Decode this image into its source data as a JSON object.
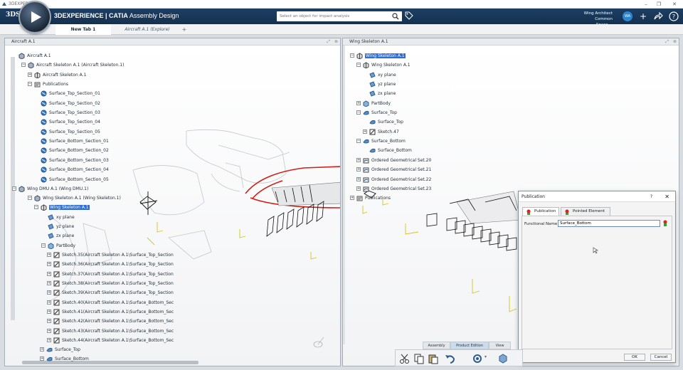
{
  "os": {
    "title": "3DEXPERIENCE",
    "minimize": "–",
    "restore": "❐",
    "close": "✕"
  },
  "header": {
    "brand_logo": "3DS",
    "app_prefix": "3DEXPERIENCE | CATIA",
    "app_name": "Assembly Design",
    "search_placeholder": "Select an object for impact analysis",
    "role": "Wing Architect",
    "space": "Common Space ⌄",
    "avatar_initials": "WA",
    "icons": [
      "plus-icon",
      "share-icon",
      "help-icon"
    ]
  },
  "tabs": [
    {
      "label": "New Tab 1",
      "active": true
    },
    {
      "label": "Aircraft A.1 (Explore)",
      "active": false
    },
    {
      "label": "+",
      "active": false
    }
  ],
  "left_window": {
    "title": "Aircraft A.1",
    "tree": [
      {
        "label": "Aircraft A.1",
        "icon": "product",
        "selected": false
      },
      {
        "label": "Aircraft Skeleton A.1 (Aircraft Skeleton.1)",
        "icon": "product",
        "selected": false
      },
      {
        "label": "Aircraft Skeleton A.1",
        "icon": "part",
        "selected": false
      },
      {
        "label": "Publications",
        "icon": "publications",
        "selected": false
      },
      {
        "label": "Surface_Top_Section_01",
        "icon": "publication",
        "selected": false
      },
      {
        "label": "Surface_Top_Section_02",
        "icon": "publication",
        "selected": false
      },
      {
        "label": "Surface_Top_Section_03",
        "icon": "publication",
        "selected": false
      },
      {
        "label": "Surface_Top_Section_04",
        "icon": "publication",
        "selected": false
      },
      {
        "label": "Surface_Top_Section_05",
        "icon": "publication",
        "selected": false
      },
      {
        "label": "Surface_Bottom_Section_01",
        "icon": "publication",
        "selected": false
      },
      {
        "label": "Surface_Bottom_Section_02",
        "icon": "publication",
        "selected": false
      },
      {
        "label": "Surface_Bottom_Section_03",
        "icon": "publication",
        "selected": false
      },
      {
        "label": "Surface_Bottom_Section_04",
        "icon": "publication",
        "selected": false
      },
      {
        "label": "Surface_Bottom_Section_05",
        "icon": "publication",
        "selected": false
      },
      {
        "label": "Wing DMU A.1 (Wing DMU.1)",
        "icon": "product",
        "selected": false
      },
      {
        "label": "Wing Skeleton A.1 (Wing Skeleton.1)",
        "icon": "product",
        "selected": false
      },
      {
        "label": "Wing Skeleton A.1",
        "icon": "part",
        "selected": true
      },
      {
        "label": "xy plane",
        "icon": "plane",
        "selected": false
      },
      {
        "label": "yz plane",
        "icon": "plane",
        "selected": false
      },
      {
        "label": "zx plane",
        "icon": "plane",
        "selected": false
      },
      {
        "label": "PartBody",
        "icon": "body",
        "selected": false
      },
      {
        "label": "Sketch.35(Aircraft Skeleton A.1\\Surface_Top_Section",
        "icon": "sketch",
        "selected": false
      },
      {
        "label": "Sketch.36(Aircraft Skeleton A.1\\Surface_Top_Section",
        "icon": "sketch",
        "selected": false
      },
      {
        "label": "Sketch.37(Aircraft Skeleton A.1\\Surface_Top_Section",
        "icon": "sketch",
        "selected": false
      },
      {
        "label": "Sketch.38(Aircraft Skeleton A.1\\Surface_Top_Section",
        "icon": "sketch",
        "selected": false
      },
      {
        "label": "Sketch.39(Aircraft Skeleton A.1\\Surface_Top_Section",
        "icon": "sketch",
        "selected": false
      },
      {
        "label": "Sketch.40(Aircraft Skeleton A.1\\Surface_Bottom_Sec",
        "icon": "sketch",
        "selected": false
      },
      {
        "label": "Sketch.41(Aircraft Skeleton A.1\\Surface_Bottom_Sec",
        "icon": "sketch",
        "selected": false
      },
      {
        "label": "Sketch.42(Aircraft Skeleton A.1\\Surface_Bottom_Sec",
        "icon": "sketch",
        "selected": false
      },
      {
        "label": "Sketch.43(Aircraft Skeleton A.1\\Surface_Bottom_Sec",
        "icon": "sketch",
        "selected": false
      },
      {
        "label": "Sketch.44(Aircraft Skeleton A.1\\Surface_Bottom_Sec",
        "icon": "sketch",
        "selected": false
      },
      {
        "label": "Surface_Top",
        "icon": "surface",
        "selected": false
      },
      {
        "label": "Surface_Bottom",
        "icon": "surface",
        "selected": false
      }
    ]
  },
  "right_window": {
    "title": "Wing Skeleton A.1",
    "tree": [
      {
        "label": "Wing Skeleton A.1",
        "icon": "part",
        "selected": true
      },
      {
        "label": "Wing Skeleton A.1",
        "icon": "part",
        "selected": false
      },
      {
        "label": "xy plane",
        "icon": "plane",
        "selected": false
      },
      {
        "label": "yz plane",
        "icon": "plane",
        "selected": false
      },
      {
        "label": "zx plane",
        "icon": "plane",
        "selected": false
      },
      {
        "label": "PartBody",
        "icon": "body",
        "selected": false
      },
      {
        "label": "Surface_Top",
        "icon": "surface",
        "selected": false
      },
      {
        "label": "Surface_Top",
        "icon": "surface",
        "selected": false
      },
      {
        "label": "Sketch.47",
        "icon": "sketch",
        "selected": false
      },
      {
        "label": "Surface_Bottom",
        "icon": "surface",
        "selected": false
      },
      {
        "label": "Surface_Bottom",
        "icon": "surface",
        "selected": false
      },
      {
        "label": "Ordered Geometrical Set.20",
        "icon": "geoset",
        "selected": false
      },
      {
        "label": "Ordered Geometrical Set.21",
        "icon": "geoset",
        "selected": false
      },
      {
        "label": "Ordered Geometrical Set.22",
        "icon": "geoset",
        "selected": false
      },
      {
        "label": "Ordered Geometrical Set.23",
        "icon": "geoset",
        "selected": false
      },
      {
        "label": "Publications",
        "icon": "publications",
        "selected": false
      }
    ]
  },
  "dialog": {
    "title": "Publication",
    "help": "?",
    "close": "✕",
    "tabs": [
      {
        "label": "Publication",
        "active": true
      },
      {
        "label": "Pointed Element",
        "active": false
      }
    ],
    "functional_name_label": "Functional Name",
    "functional_name_value": "Surface_Bottom",
    "ok_label": "OK",
    "cancel_label": "Cancel"
  },
  "action_bar": {
    "tabs": [
      {
        "label": "Assembly",
        "active": false
      },
      {
        "label": "Product Edition",
        "active": true
      },
      {
        "label": "View",
        "active": false
      }
    ],
    "tools": [
      "cut-icon",
      "copy-icon",
      "paste-icon",
      "undo-icon",
      "update-icon",
      "view-icon"
    ]
  },
  "colors": {
    "header_bg": "#14314f",
    "selection": "#2d6fd6",
    "wing_red": "#d0201a",
    "axis_yellow": "#d6c51a"
  }
}
